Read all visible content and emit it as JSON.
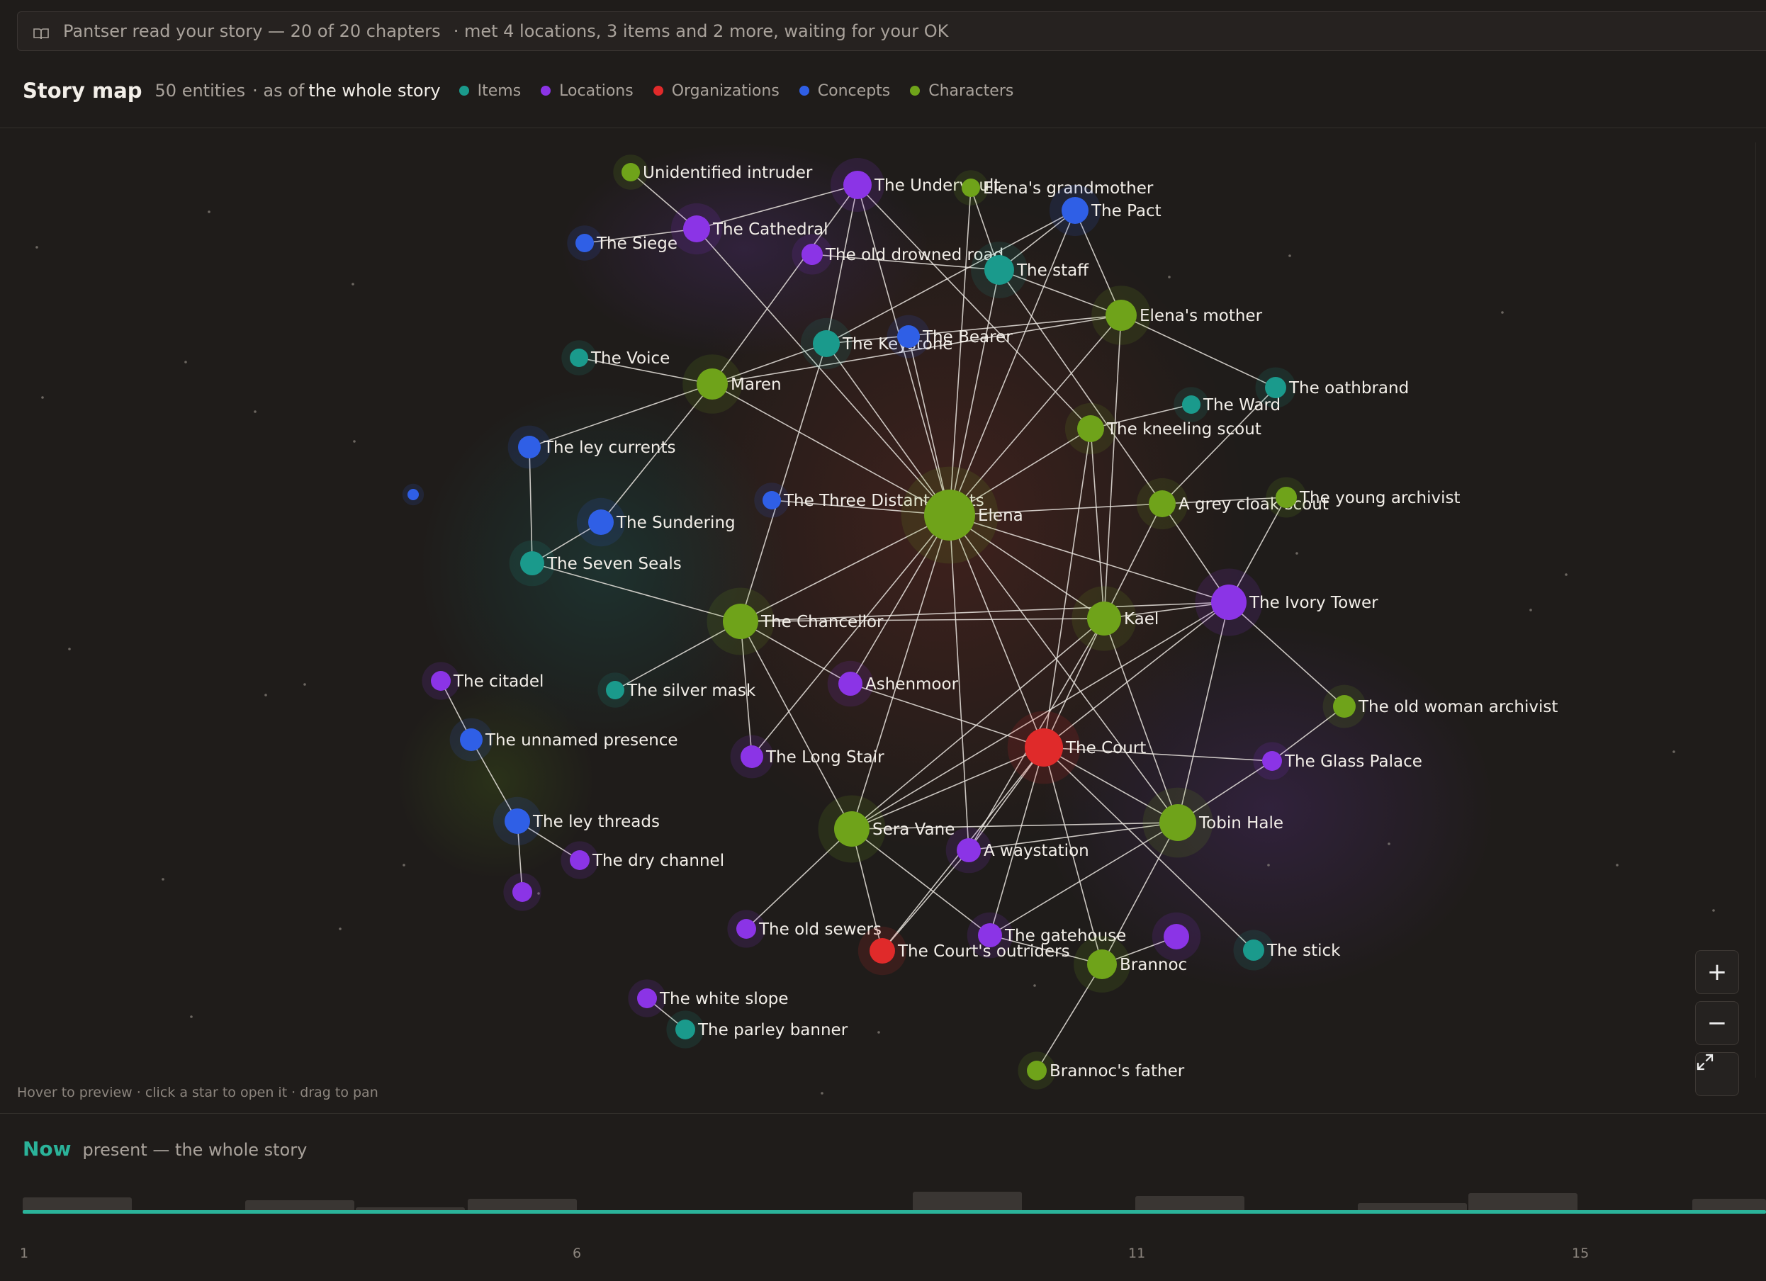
{
  "banner": {
    "text": "Pantser read your story — 20 of 20 chapters",
    "extra": "· met 4 locations, 3 items and 2 more, waiting for your OK"
  },
  "header": {
    "title": "Story map",
    "count": "50 entities",
    "as_of": "· as of",
    "scope": "the whole story"
  },
  "legend": [
    {
      "label": "Items",
      "color": "#1a9a8c"
    },
    {
      "label": "Locations",
      "color": "#8b34e6"
    },
    {
      "label": "Organizations",
      "color": "#e02a2a"
    },
    {
      "label": "Concepts",
      "color": "#2f5fe6"
    },
    {
      "label": "Characters",
      "color": "#6fa31a"
    }
  ],
  "colors": {
    "item": "#1a9a8c",
    "location": "#8b34e6",
    "organization": "#e02a2a",
    "concept": "#2f5fe6",
    "character": "#6fa31a",
    "accent": "#2bb39a"
  },
  "map": {
    "hint": "Hover to preview · click a star to open it · drag to pan",
    "zoom_in": "+",
    "zoom_out": "−",
    "fit_icon": "expand-icon",
    "nodes": [
      {
        "id": "unidentified-intruder",
        "label": "Unidentified intruder",
        "type": "character"
      },
      {
        "id": "the-undervault",
        "label": "The Undervault",
        "type": "location"
      },
      {
        "id": "elenas-grandmother",
        "label": "Elena's grandmother",
        "type": "character"
      },
      {
        "id": "the-pact",
        "label": "The Pact",
        "type": "concept"
      },
      {
        "id": "the-siege",
        "label": "The Siege",
        "type": "concept"
      },
      {
        "id": "the-cathedral",
        "label": "The Cathedral",
        "type": "location"
      },
      {
        "id": "the-old-drowned-road",
        "label": "The old drowned road",
        "type": "location"
      },
      {
        "id": "the-staff",
        "label": "The staff",
        "type": "item"
      },
      {
        "id": "elenas-mother",
        "label": "Elena's mother",
        "type": "character"
      },
      {
        "id": "the-keystone",
        "label": "The Keystone",
        "type": "item"
      },
      {
        "id": "the-bearer",
        "label": "The Bearer",
        "type": "concept"
      },
      {
        "id": "the-voice",
        "label": "The Voice",
        "type": "item"
      },
      {
        "id": "maren",
        "label": "Maren",
        "type": "character"
      },
      {
        "id": "the-oathbrand",
        "label": "The oathbrand",
        "type": "item"
      },
      {
        "id": "the-ward",
        "label": "The Ward",
        "type": "item"
      },
      {
        "id": "the-kneeling-scout",
        "label": "The kneeling scout",
        "type": "character"
      },
      {
        "id": "the-ley-currents",
        "label": "The ley currents",
        "type": "concept"
      },
      {
        "id": "unlabeled-concept",
        "label": "",
        "type": "concept"
      },
      {
        "id": "the-three-distant-lights",
        "label": "The Three Distant Lights",
        "type": "concept"
      },
      {
        "id": "elena",
        "label": "Elena",
        "type": "character"
      },
      {
        "id": "a-grey-cloak-scout",
        "label": "A grey cloak scout",
        "type": "character"
      },
      {
        "id": "the-young-archivist",
        "label": "The young archivist",
        "type": "character"
      },
      {
        "id": "the-sundering",
        "label": "The Sundering",
        "type": "concept"
      },
      {
        "id": "the-seven-seals",
        "label": "The Seven Seals",
        "type": "item"
      },
      {
        "id": "the-ivory-tower",
        "label": "The Ivory Tower",
        "type": "location"
      },
      {
        "id": "the-chancellor",
        "label": "The Chancellor",
        "type": "character"
      },
      {
        "id": "kael",
        "label": "Kael",
        "type": "character"
      },
      {
        "id": "the-citadel",
        "label": "The citadel",
        "type": "location"
      },
      {
        "id": "the-silver-mask",
        "label": "The silver mask",
        "type": "item"
      },
      {
        "id": "ashenmoor",
        "label": "Ashenmoor",
        "type": "location"
      },
      {
        "id": "the-old-woman-archivist",
        "label": "The old woman archivist",
        "type": "character"
      },
      {
        "id": "the-unnamed-presence",
        "label": "The unnamed presence",
        "type": "concept"
      },
      {
        "id": "the-court",
        "label": "The Court",
        "type": "organization"
      },
      {
        "id": "the-long-stair",
        "label": "The Long Stair",
        "type": "location"
      },
      {
        "id": "the-glass-palace",
        "label": "The Glass Palace",
        "type": "location"
      },
      {
        "id": "the-ley-threads",
        "label": "The ley threads",
        "type": "concept"
      },
      {
        "id": "sera-vane",
        "label": "Sera Vane",
        "type": "character"
      },
      {
        "id": "tobin-hale",
        "label": "Tobin Hale",
        "type": "character"
      },
      {
        "id": "a-waystation",
        "label": "A waystation",
        "type": "location"
      },
      {
        "id": "the-dry-channel",
        "label": "The dry channel",
        "type": "location"
      },
      {
        "id": "unlabeled-location-a",
        "label": "",
        "type": "location"
      },
      {
        "id": "the-old-sewers",
        "label": "The old sewers",
        "type": "location"
      },
      {
        "id": "the-gatehouse",
        "label": "The gatehouse",
        "type": "location"
      },
      {
        "id": "unlabeled-location-b",
        "label": "",
        "type": "location"
      },
      {
        "id": "the-courts-outriders",
        "label": "The Court's outriders",
        "type": "organization"
      },
      {
        "id": "brannoc",
        "label": "Brannoc",
        "type": "character"
      },
      {
        "id": "the-stick",
        "label": "The stick",
        "type": "item"
      },
      {
        "id": "the-white-slope",
        "label": "The white slope",
        "type": "location"
      },
      {
        "id": "the-parley-banner",
        "label": "The parley banner",
        "type": "item"
      },
      {
        "id": "brannocs-father",
        "label": "Brannoc's father",
        "type": "character"
      }
    ],
    "edges": [
      [
        "unidentified-intruder",
        "the-cathedral"
      ],
      [
        "the-siege",
        "the-cathedral"
      ],
      [
        "the-cathedral",
        "the-undervault"
      ],
      [
        "the-cathedral",
        "elena"
      ],
      [
        "the-undervault",
        "maren"
      ],
      [
        "the-undervault",
        "elena"
      ],
      [
        "the-undervault",
        "the-keystone"
      ],
      [
        "the-undervault",
        "the-kneeling-scout"
      ],
      [
        "elenas-grandmother",
        "elena"
      ],
      [
        "elenas-grandmother",
        "the-staff"
      ],
      [
        "the-pact",
        "the-staff"
      ],
      [
        "the-pact",
        "elenas-mother"
      ],
      [
        "the-pact",
        "elena"
      ],
      [
        "the-pact",
        "the-keystone"
      ],
      [
        "the-old-drowned-road",
        "the-staff"
      ],
      [
        "the-staff",
        "elena"
      ],
      [
        "the-staff",
        "elenas-mother"
      ],
      [
        "the-staff",
        "a-grey-cloak-scout"
      ],
      [
        "elenas-mother",
        "maren"
      ],
      [
        "elenas-mother",
        "elena"
      ],
      [
        "elenas-mother",
        "the-oathbrand"
      ],
      [
        "elenas-mother",
        "kael"
      ],
      [
        "elenas-mother",
        "the-keystone"
      ],
      [
        "the-keystone",
        "maren"
      ],
      [
        "the-keystone",
        "elena"
      ],
      [
        "the-keystone",
        "the-chancellor"
      ],
      [
        "the-bearer",
        "elena"
      ],
      [
        "the-voice",
        "maren"
      ],
      [
        "maren",
        "the-ley-currents"
      ],
      [
        "maren",
        "the-sundering"
      ],
      [
        "maren",
        "elena"
      ],
      [
        "the-oathbrand",
        "a-grey-cloak-scout"
      ],
      [
        "the-ward",
        "the-kneeling-scout"
      ],
      [
        "the-kneeling-scout",
        "elena"
      ],
      [
        "the-kneeling-scout",
        "kael"
      ],
      [
        "the-kneeling-scout",
        "the-court"
      ],
      [
        "the-ley-currents",
        "the-seven-seals"
      ],
      [
        "the-sundering",
        "the-seven-seals"
      ],
      [
        "the-three-distant-lights",
        "elena"
      ],
      [
        "elena",
        "a-grey-cloak-scout"
      ],
      [
        "elena",
        "the-chancellor"
      ],
      [
        "elena",
        "kael"
      ],
      [
        "elena",
        "the-ivory-tower"
      ],
      [
        "elena",
        "ashenmoor"
      ],
      [
        "elena",
        "the-court"
      ],
      [
        "elena",
        "sera-vane"
      ],
      [
        "elena",
        "tobin-hale"
      ],
      [
        "elena",
        "a-waystation"
      ],
      [
        "elena",
        "the-long-stair"
      ],
      [
        "a-grey-cloak-scout",
        "the-young-archivist"
      ],
      [
        "a-grey-cloak-scout",
        "kael"
      ],
      [
        "a-grey-cloak-scout",
        "the-ivory-tower"
      ],
      [
        "the-young-archivist",
        "the-ivory-tower"
      ],
      [
        "the-seven-seals",
        "the-chancellor"
      ],
      [
        "the-chancellor",
        "kael"
      ],
      [
        "the-chancellor",
        "the-ivory-tower"
      ],
      [
        "the-chancellor",
        "the-silver-mask"
      ],
      [
        "the-chancellor",
        "ashenmoor"
      ],
      [
        "the-chancellor",
        "sera-vane"
      ],
      [
        "the-chancellor",
        "the-long-stair"
      ],
      [
        "kael",
        "the-ivory-tower"
      ],
      [
        "kael",
        "the-court"
      ],
      [
        "kael",
        "sera-vane"
      ],
      [
        "kael",
        "tobin-hale"
      ],
      [
        "kael",
        "a-waystation"
      ],
      [
        "the-ivory-tower",
        "the-old-woman-archivist"
      ],
      [
        "the-ivory-tower",
        "the-court"
      ],
      [
        "the-ivory-tower",
        "tobin-hale"
      ],
      [
        "the-ivory-tower",
        "sera-vane"
      ],
      [
        "ashenmoor",
        "the-court"
      ],
      [
        "the-citadel",
        "the-unnamed-presence"
      ],
      [
        "the-unnamed-presence",
        "the-ley-threads"
      ],
      [
        "the-ley-threads",
        "the-dry-channel"
      ],
      [
        "the-ley-threads",
        "unlabeled-location-a"
      ],
      [
        "the-court",
        "sera-vane"
      ],
      [
        "the-court",
        "the-glass-palace"
      ],
      [
        "the-court",
        "tobin-hale"
      ],
      [
        "the-court",
        "a-waystation"
      ],
      [
        "the-court",
        "the-courts-outriders"
      ],
      [
        "the-court",
        "brannoc"
      ],
      [
        "the-court",
        "the-gatehouse"
      ],
      [
        "the-court",
        "the-stick"
      ],
      [
        "the-glass-palace",
        "the-old-woman-archivist"
      ],
      [
        "the-glass-palace",
        "tobin-hale"
      ],
      [
        "sera-vane",
        "tobin-hale"
      ],
      [
        "sera-vane",
        "the-old-sewers"
      ],
      [
        "sera-vane",
        "the-courts-outriders"
      ],
      [
        "sera-vane",
        "the-gatehouse"
      ],
      [
        "tobin-hale",
        "the-gatehouse"
      ],
      [
        "tobin-hale",
        "brannoc"
      ],
      [
        "tobin-hale",
        "a-waystation"
      ],
      [
        "a-waystation",
        "the-courts-outriders"
      ],
      [
        "brannoc",
        "unlabeled-location-b"
      ],
      [
        "brannoc",
        "brannocs-father"
      ],
      [
        "the-gatehouse",
        "brannoc"
      ],
      [
        "the-white-slope",
        "the-parley-banner"
      ]
    ]
  },
  "timeline": {
    "now_label": "Now",
    "now_desc": "present — the whole story",
    "ticks": [
      "1",
      "6",
      "11",
      "15"
    ],
    "progress": 1.0
  }
}
